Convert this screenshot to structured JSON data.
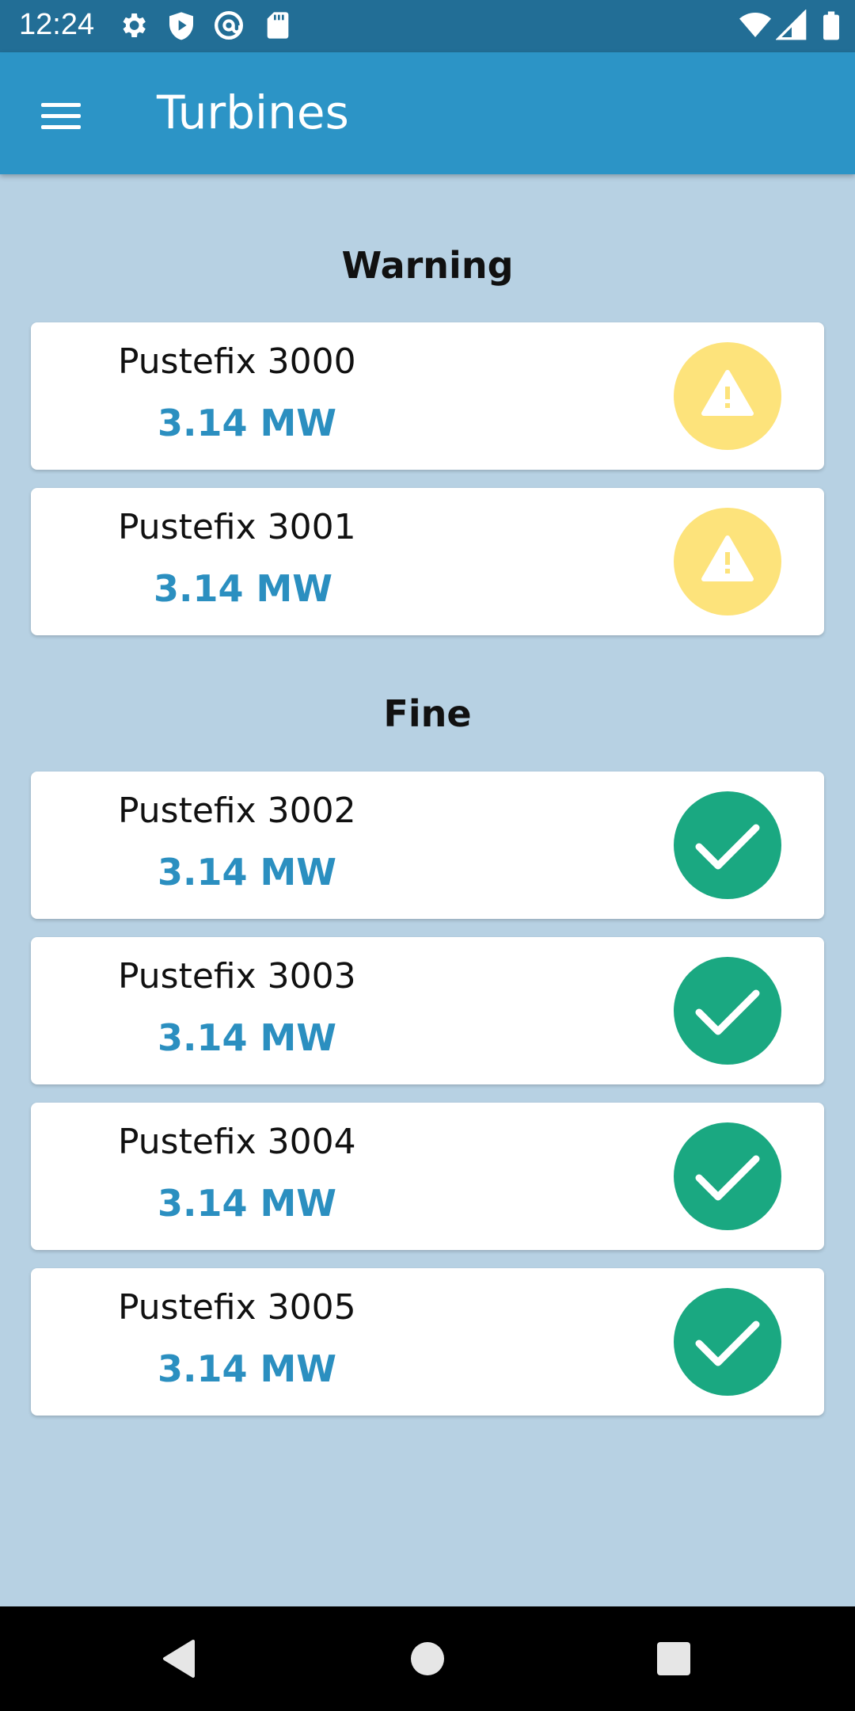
{
  "status_bar": {
    "time": "12:24",
    "icons": [
      "gear-icon",
      "shield-icon",
      "at-sign-icon",
      "sd-card-icon",
      "wifi-icon",
      "signal-icon",
      "battery-icon"
    ]
  },
  "app_bar": {
    "title": "Turbines",
    "menu_icon": "hamburger-menu-icon"
  },
  "colors": {
    "status_bar": "#226e96",
    "app_bar": "#2c94c6",
    "background": "#b7d1e3",
    "power_text": "#2b8fc0",
    "warning": "#fde37b",
    "fine": "#1aa881"
  },
  "sections": [
    {
      "title": "Warning",
      "turbines": [
        {
          "name": "Pustefix 3000",
          "power": "3.14 MW",
          "status_icon": "warning-icon"
        },
        {
          "name": "Pustefix 3001",
          "power": "3.14 MW",
          "status_icon": "warning-icon"
        }
      ]
    },
    {
      "title": "Fine",
      "turbines": [
        {
          "name": "Pustefix 3002",
          "power": "3.14 MW",
          "status_icon": "check-icon"
        },
        {
          "name": "Pustefix 3003",
          "power": "3.14 MW",
          "status_icon": "check-icon"
        },
        {
          "name": "Pustefix 3004",
          "power": "3.14 MW",
          "status_icon": "check-icon"
        },
        {
          "name": "Pustefix 3005",
          "power": "3.14 MW",
          "status_icon": "check-icon"
        }
      ]
    }
  ],
  "nav_bar": {
    "icons": [
      "back-icon",
      "home-icon",
      "recents-icon"
    ]
  }
}
